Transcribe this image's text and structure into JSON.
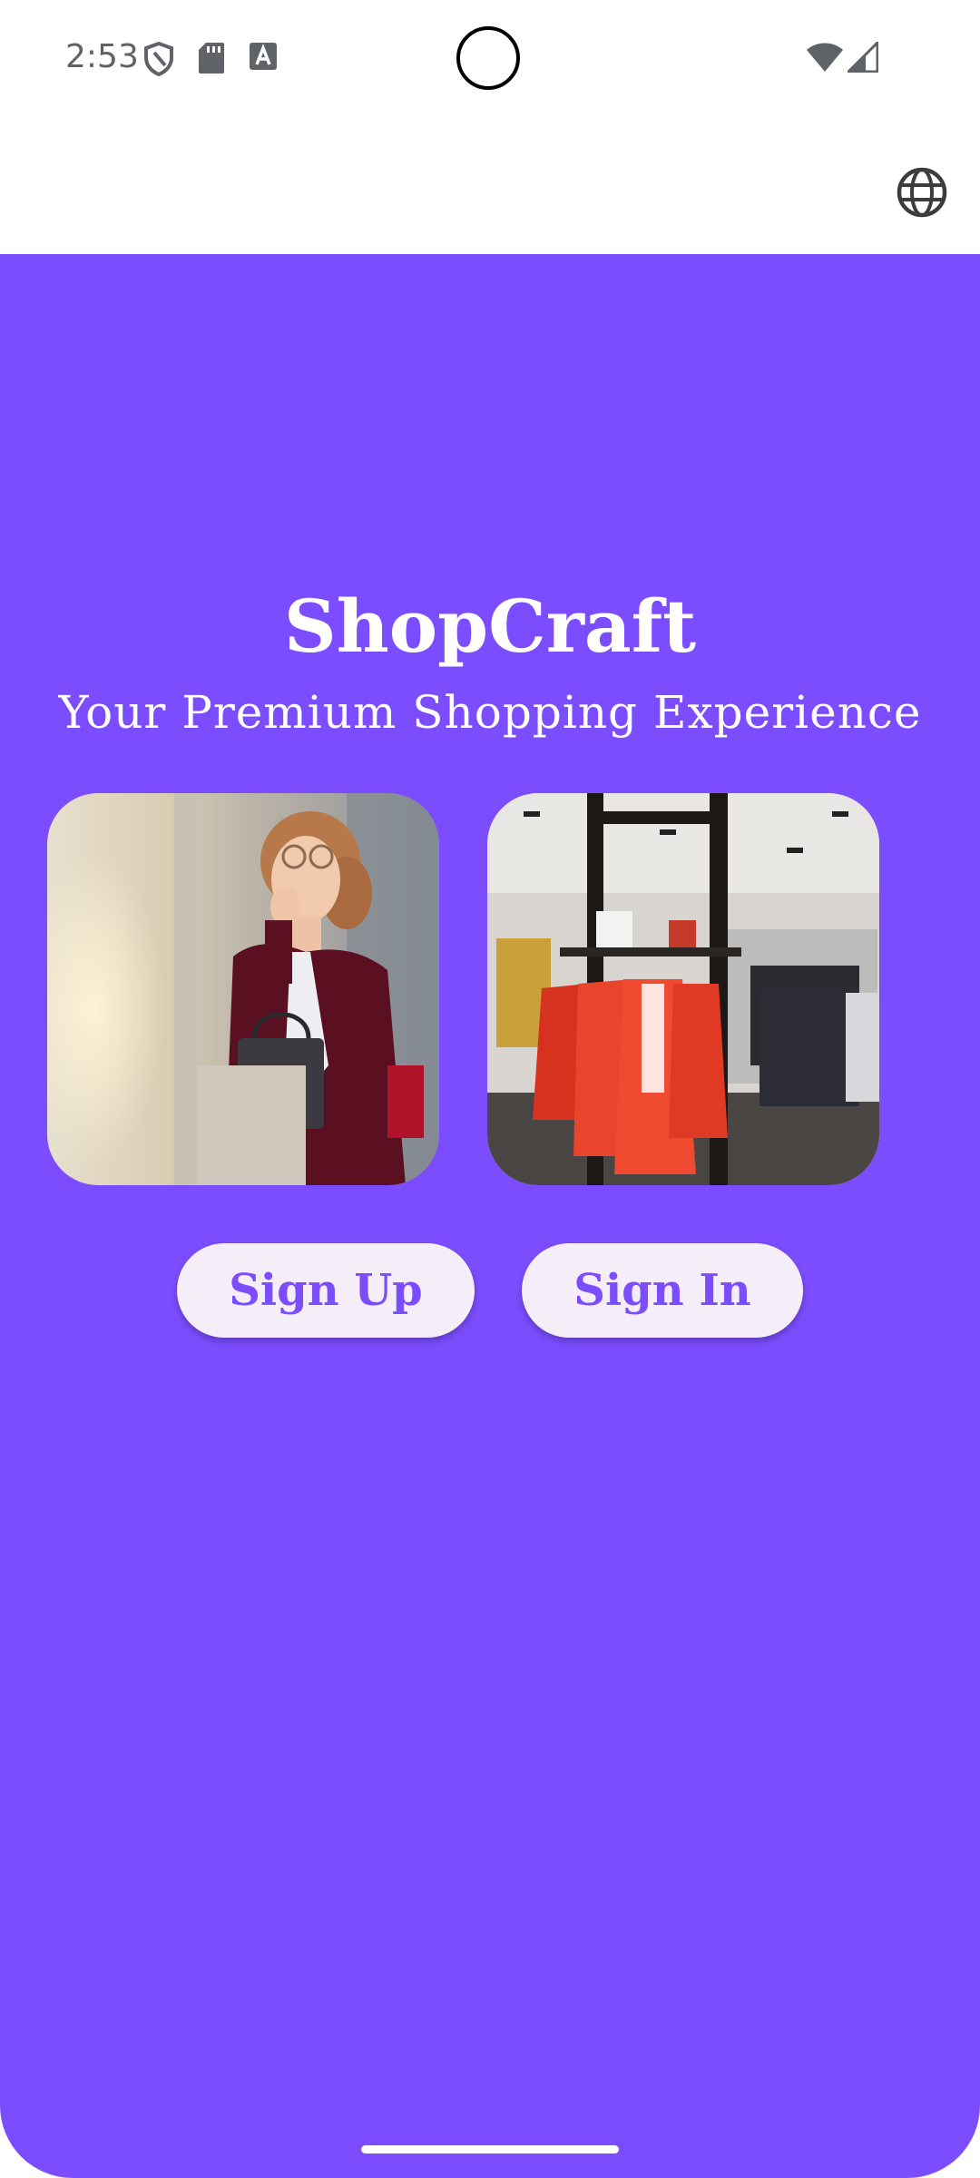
{
  "status_bar": {
    "time": "2:53",
    "icons": [
      "shield-icon",
      "sd-card-icon",
      "font-a-icon",
      "wifi-icon",
      "signal-icon"
    ]
  },
  "app_bar": {
    "language_icon": "globe-icon"
  },
  "hero": {
    "title": "ShopCraft",
    "tagline": "Your Premium Shopping Experience",
    "images": [
      "woman-shopping-photo",
      "clothing-store-photo"
    ]
  },
  "actions": {
    "sign_up_label": "Sign Up",
    "sign_in_label": "Sign In"
  },
  "colors": {
    "primary": "#7c4dff",
    "button_bg": "#f5eef8",
    "text_on_primary": "#ffffff"
  }
}
